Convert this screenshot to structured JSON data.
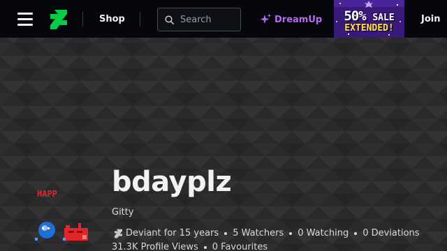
{
  "header": {
    "menu_icon": "hamburger-menu-icon",
    "logo_icon": "deviantart-logo-icon",
    "shop_label": "Shop",
    "search": {
      "placeholder": "Search",
      "value": ""
    },
    "dreamup_label": "DreamUp",
    "promo": {
      "percent": "50%",
      "word": "SALE",
      "line2": "EXTENDED!"
    },
    "join_label": "Join"
  },
  "profile": {
    "avatar_text": "HAPP",
    "username": "bdayplz",
    "tagline": "Gitty",
    "deviant_for": "Deviant for 15 years",
    "watchers": "5 Watchers",
    "watching": "0 Watching",
    "deviations": "0 Deviations",
    "profile_views": "31.3K Profile Views",
    "favourites": "0 Favourites"
  },
  "colors": {
    "topbar_bg": "#06070d",
    "banner_bg": "#2a2a2c",
    "brand_green": "#05cc47",
    "dreamup_purple": "#b46bf0",
    "promo_bg": "#3a1a78",
    "promo_yellow": "#ffe13a"
  }
}
